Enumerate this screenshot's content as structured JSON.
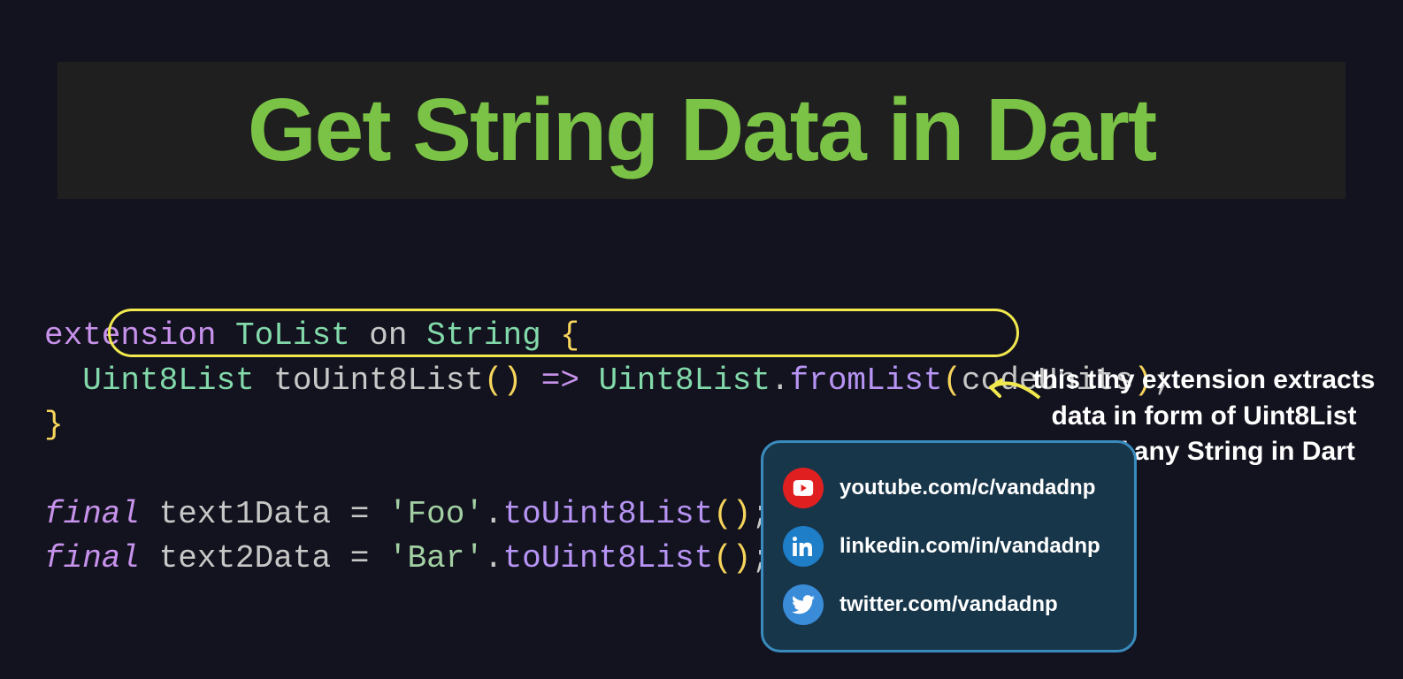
{
  "title": "Get String Data in Dart",
  "code": {
    "line1": {
      "kw": "extension",
      "name": "ToList",
      "on": "on",
      "type": "String",
      "open": "{"
    },
    "line2": {
      "ret": "Uint8List",
      "method": "toUint8List",
      "parens": "()",
      "arrow": "=>",
      "cls": "Uint8List",
      "dot": ".",
      "call": "fromList",
      "lp": "(",
      "arg": "codeUnits",
      "rp": ")",
      "semi": ";"
    },
    "line3": {
      "close": "}"
    },
    "line5": {
      "kw": "final",
      "var": "text1Data",
      "eq": "=",
      "str": "'Foo'",
      "dot": ".",
      "call": "toUint8List",
      "lp": "(",
      "rp": ")",
      "semi": ";"
    },
    "line6": {
      "kw": "final",
      "var": "text2Data",
      "eq": "=",
      "str": "'Bar'",
      "dot": ".",
      "call": "toUint8List",
      "lp": "(",
      "rp": ")",
      "semi": ";"
    }
  },
  "annotation": "this tiny extension extracts data in form of Uint8List out of any String in Dart",
  "social": {
    "youtube": "youtube.com/c/vandadnp",
    "linkedin": "linkedin.com/in/vandadnp",
    "twitter": "twitter.com/vandadnp"
  }
}
